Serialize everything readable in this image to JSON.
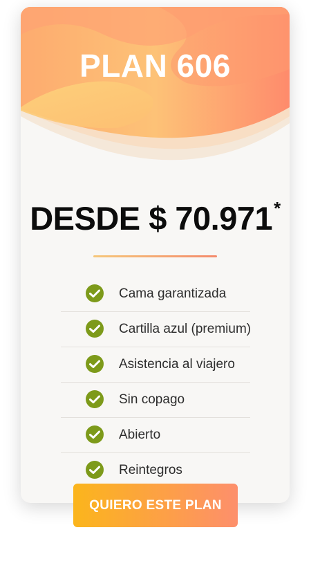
{
  "plan": {
    "title": "PLAN 606"
  },
  "price": {
    "text": "DESDE $ 70.971",
    "asterisk": "*"
  },
  "features": [
    {
      "label": "Cama garantizada",
      "icon": "check-circle-icon"
    },
    {
      "label": "Cartilla azul (premium)",
      "icon": "check-circle-icon"
    },
    {
      "label": "Asistencia al viajero",
      "icon": "check-circle-icon"
    },
    {
      "label": "Sin copago",
      "icon": "check-circle-icon"
    },
    {
      "label": "Abierto",
      "icon": "check-circle-icon"
    },
    {
      "label": "Reintegros",
      "icon": "check-circle-icon"
    }
  ],
  "cta": {
    "label": "QUIERO ESTE PLAN"
  },
  "colors": {
    "check": "#7d9a1a",
    "header_start": "#fdd27d",
    "header_end": "#fe8a6c",
    "button_start": "#fbb51c",
    "button_end": "#fd8f6c"
  }
}
